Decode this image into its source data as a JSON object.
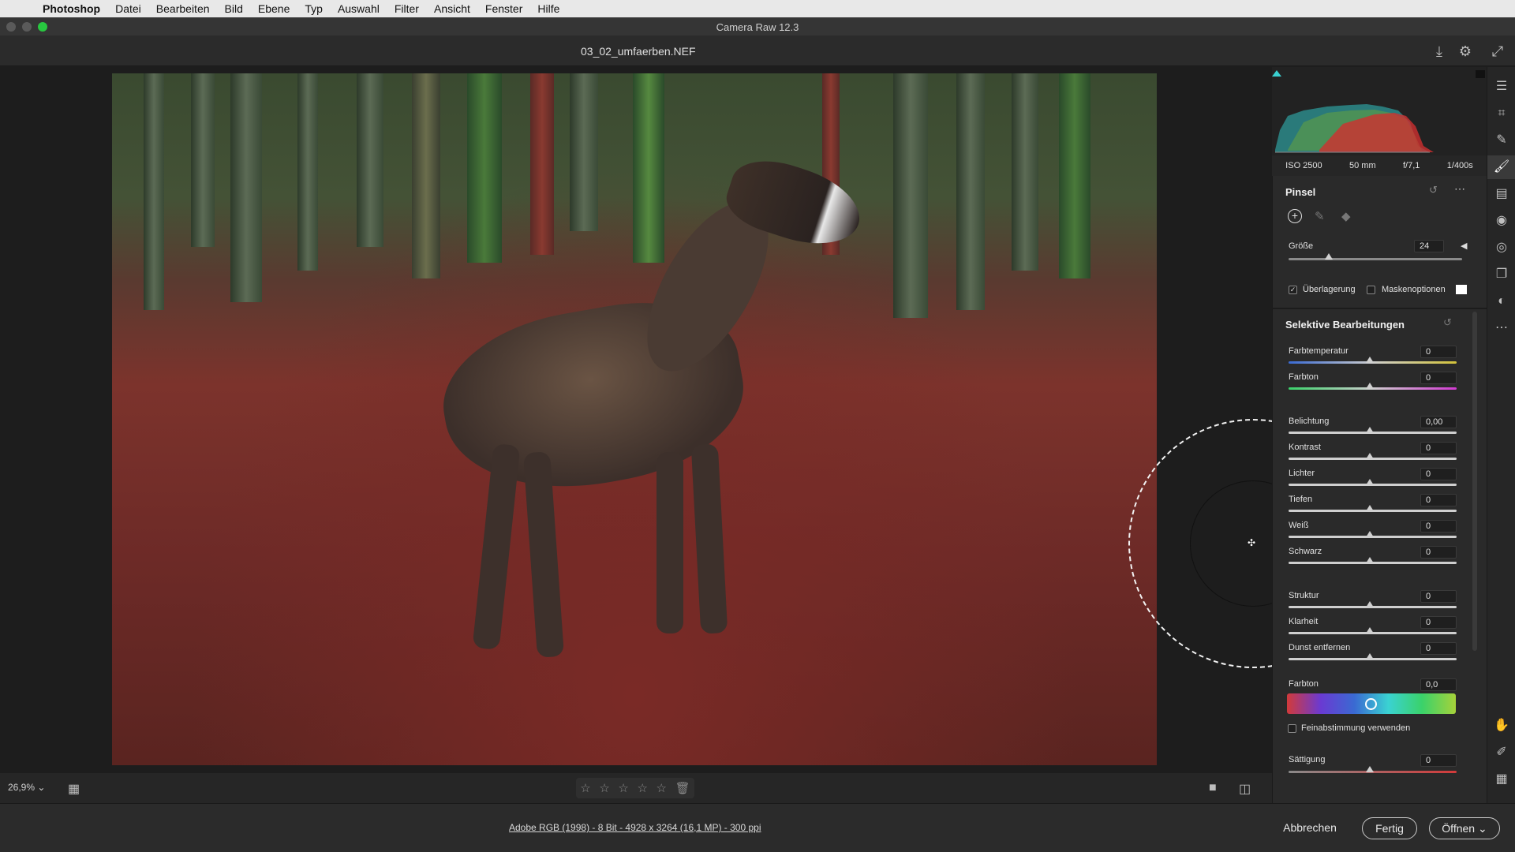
{
  "menubar": {
    "apple": "",
    "items": [
      "Photoshop",
      "Datei",
      "Bearbeiten",
      "Bild",
      "Ebene",
      "Typ",
      "Auswahl",
      "Filter",
      "Ansicht",
      "Fenster",
      "Hilfe"
    ]
  },
  "window": {
    "title": "Camera Raw 12.3"
  },
  "file": {
    "name": "03_02_umfaerben.NEF"
  },
  "exif": {
    "iso": "ISO 2500",
    "focal": "50 mm",
    "aperture": "f/7,1",
    "shutter": "1/400s"
  },
  "brush_panel": {
    "title": "Pinsel",
    "size_label": "Größe",
    "size_value": "24",
    "size_fraction": 0.24,
    "overlay_label": "Überlagerung",
    "overlay_checked": true,
    "mask_label": "Maskenoptionen",
    "mask_checked": false
  },
  "selective": {
    "title": "Selektive Bearbeitungen",
    "sliders": [
      {
        "label": "Farbtemperatur",
        "value": "0"
      },
      {
        "label": "Farbton",
        "value": "0"
      },
      {
        "label": "Belichtung",
        "value": "0,00"
      },
      {
        "label": "Kontrast",
        "value": "0"
      },
      {
        "label": "Lichter",
        "value": "0"
      },
      {
        "label": "Tiefen",
        "value": "0"
      },
      {
        "label": "Weiß",
        "value": "0"
      },
      {
        "label": "Schwarz",
        "value": "0"
      },
      {
        "label": "Struktur",
        "value": "0"
      },
      {
        "label": "Klarheit",
        "value": "0"
      },
      {
        "label": "Dunst entfernen",
        "value": "0"
      }
    ],
    "hue_label": "Farbton",
    "hue_value": "0,0",
    "fine_label": "Feinabstimmung verwenden",
    "fine_checked": false,
    "sat_label": "Sättigung",
    "sat_value": "0"
  },
  "canvas": {
    "zoom": "26,9%"
  },
  "footer": {
    "info": "Adobe RGB (1998) - 8 Bit - 4928 x 3264 (16,1 MP) - 300 ppi",
    "cancel": "Abbrechen",
    "done": "Fertig",
    "open": "Öffnen"
  },
  "colors": {
    "accent_green": "#28c840",
    "panel_bg": "#2a2a2a",
    "canvas_bg": "#1d1d1d"
  }
}
